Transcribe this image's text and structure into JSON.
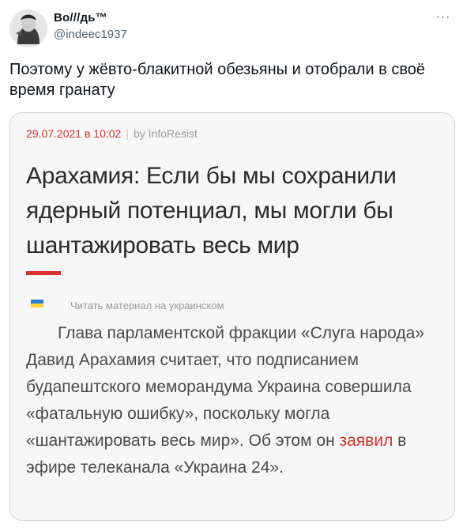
{
  "author": {
    "name": "Во///дь™",
    "handle": "@indeec1937"
  },
  "more_icon": "more-horizontal-icon",
  "more_glyph": "···",
  "tweet_text": "Поэтому у жёвто-блакитной обезьяны и отобрали в своё время гранату",
  "article": {
    "date": "29.07.2021 в 10:02",
    "separator": "|",
    "source": "by InfoResist",
    "title": "Арахамия: Если бы мы сохранили ядерный потенциал, мы могли бы шантажировать весь мир",
    "ua_link": "Читать материал на украинском",
    "body_before_link": "Глава парламентской фракции «Слуга народа» Давид Арахамия считает, что подписанием будапештского меморандума Украина совершила «фатальную ошибку», поскольку могла «шантажировать весь мир». Об этом он ",
    "body_link": "заявил",
    "body_after_link": " в эфире телеканала «Украина 24»."
  },
  "colors": {
    "accent_red": "#d9302b",
    "handle_gray": "#536471",
    "border": "#cfd9de",
    "flag_blue": "#2f78d6",
    "flag_yellow": "#ffd23a"
  }
}
